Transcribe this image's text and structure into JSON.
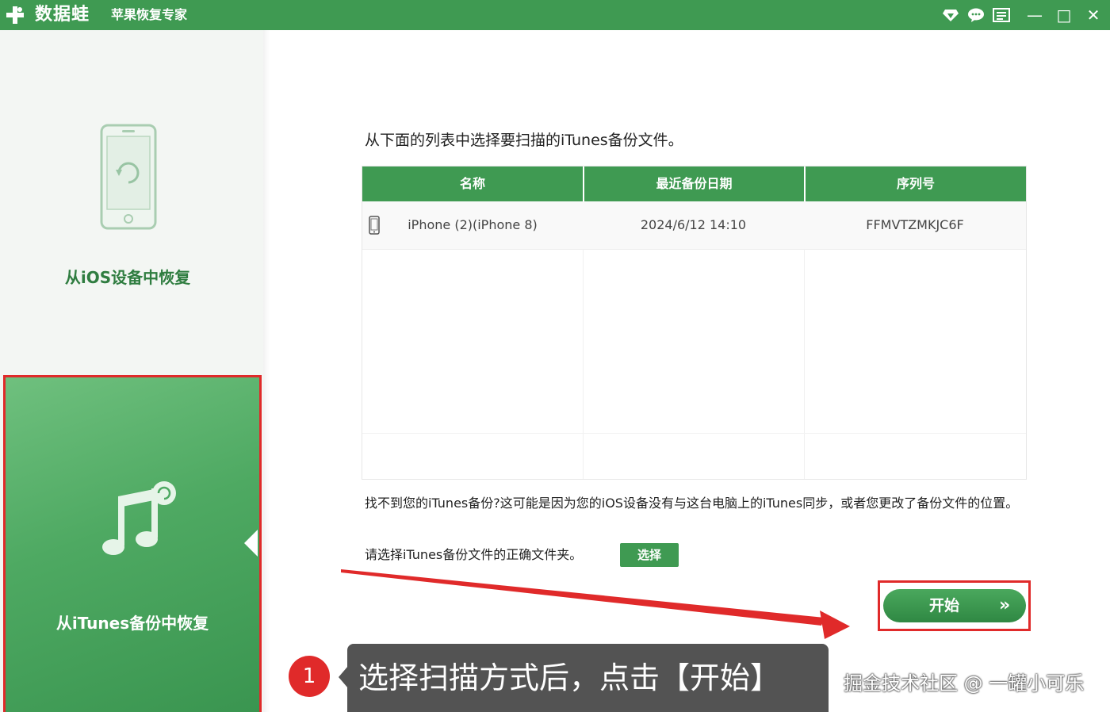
{
  "titlebar": {
    "brand": "数据蛙",
    "subtitle": "苹果恢复专家",
    "icons": [
      "diamond-icon",
      "chat-icon",
      "menu-list-icon"
    ],
    "minimize": "—",
    "maximize": "□",
    "close": "✕",
    "color": "#3f9a52"
  },
  "sidebar": {
    "ios_option": {
      "label": "从iOS设备中恢复",
      "icon": "phone-restore-icon"
    },
    "itunes_option": {
      "label": "从iTunes备份中恢复",
      "icon": "music-note-icon",
      "selected": true
    }
  },
  "main": {
    "instruction": "从下面的列表中选择要扫描的iTunes备份文件。",
    "table": {
      "columns": [
        "名称",
        "最近备份日期",
        "序列号"
      ],
      "rows": [
        {
          "name": "iPhone (2)(iPhone 8)",
          "date": "2024/6/12 14:10",
          "serial": "FFMVTZMKJC6F"
        }
      ]
    },
    "help_text": "找不到您的iTunes备份?这可能是因为您的iOS设备没有与这台电脑上的iTunes同步，或者您更改了备份文件的位置。",
    "folder_text": "请选择iTunes备份文件的正确文件夹。",
    "choose_button": "选择",
    "start_button": "开始",
    "start_chevron": "»"
  },
  "annotation": {
    "step_number": "1",
    "callout": "选择扫描方式后，点击【开始】",
    "highlight_color": "#e02a2a"
  },
  "watermark": "掘金技术社区 @ 一罐小可乐"
}
